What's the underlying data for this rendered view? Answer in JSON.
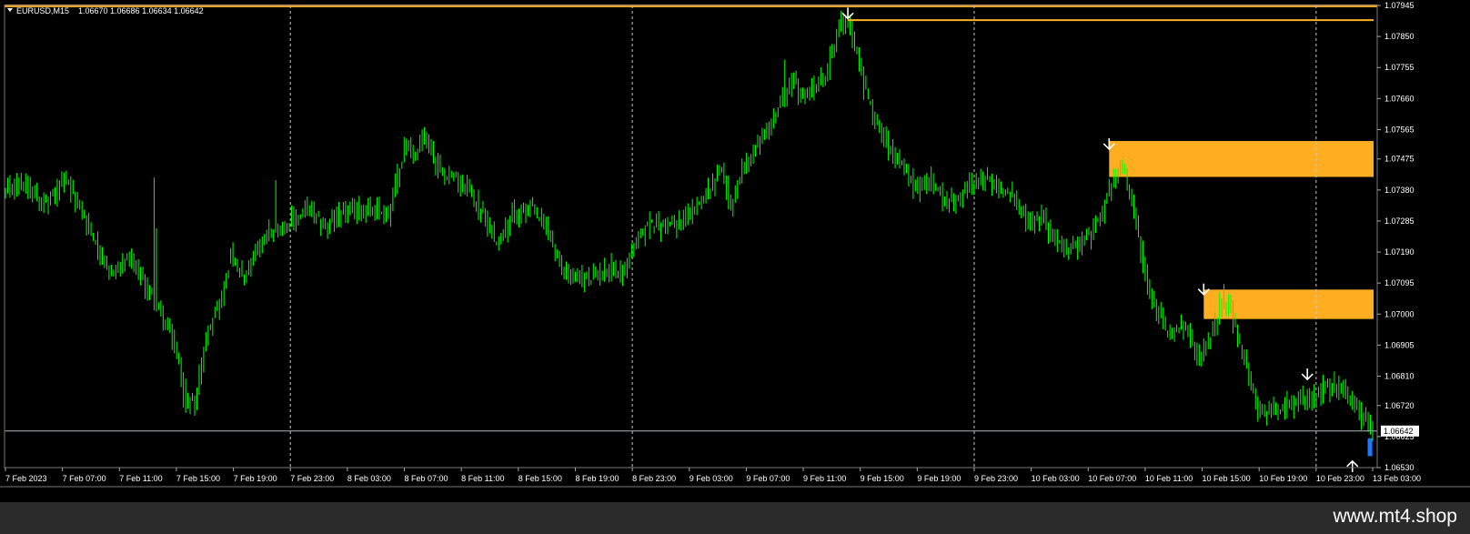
{
  "header": {
    "symbol": "EURUSD,M15",
    "quote": "1.06670 1.06686 1.06634 1.06642"
  },
  "footer": {
    "brand": "www.mt4.shop"
  },
  "colors": {
    "background": "#000000",
    "candle": "#00ff00",
    "zone": "#ffae22",
    "current_price_line": "#aab4c0",
    "grid": "#c8c8c8",
    "arrow": "#ffffff",
    "current_bar": "#1e78ff"
  },
  "chart_data": {
    "type": "candlestick",
    "symbol": "EURUSD",
    "timeframe": "M15",
    "ylim": [
      1.0653,
      1.07945
    ],
    "y_ticks": [
      "1.07945",
      "1.07850",
      "1.07755",
      "1.07660",
      "1.07565",
      "1.07475",
      "1.07380",
      "1.07285",
      "1.07190",
      "1.07095",
      "1.07000",
      "1.06905",
      "1.06810",
      "1.06720",
      "1.06625",
      "1.06530"
    ],
    "x_ticks": [
      "7 Feb 2023",
      "7 Feb 07:00",
      "7 Feb 11:00",
      "7 Feb 15:00",
      "7 Feb 19:00",
      "7 Feb 23:00",
      "8 Feb 03:00",
      "8 Feb 07:00",
      "8 Feb 11:00",
      "8 Feb 15:00",
      "8 Feb 19:00",
      "8 Feb 23:00",
      "9 Feb 03:00",
      "9 Feb 07:00",
      "9 Feb 11:00",
      "9 Feb 15:00",
      "9 Feb 19:00",
      "9 Feb 23:00",
      "10 Feb 03:00",
      "10 Feb 07:00",
      "10 Feb 11:00",
      "10 Feb 15:00",
      "10 Feb 19:00",
      "10 Feb 23:00",
      "13 Feb 03:00"
    ],
    "grid": "vertical dashed at 7 Feb 23:00, 8 Feb 23:00, 9 Feb 23:00, 10 Feb 23:00",
    "current_price": "1.06642",
    "close_path": [
      {
        "i": 0,
        "p": 1.0737
      },
      {
        "i": 6,
        "p": 1.0741
      },
      {
        "i": 12,
        "p": 1.0738
      },
      {
        "i": 18,
        "p": 1.0733
      },
      {
        "i": 26,
        "p": 1.0741
      },
      {
        "i": 32,
        "p": 1.0734
      },
      {
        "i": 40,
        "p": 1.0722
      },
      {
        "i": 46,
        "p": 1.0712
      },
      {
        "i": 54,
        "p": 1.0717
      },
      {
        "i": 60,
        "p": 1.0711
      },
      {
        "i": 68,
        "p": 1.0702
      },
      {
        "i": 76,
        "p": 1.0688
      },
      {
        "i": 80,
        "p": 1.0672
      },
      {
        "i": 84,
        "p": 1.0674
      },
      {
        "i": 90,
        "p": 1.0696
      },
      {
        "i": 96,
        "p": 1.0705
      },
      {
        "i": 100,
        "p": 1.0718
      },
      {
        "i": 106,
        "p": 1.071
      },
      {
        "i": 112,
        "p": 1.0721
      },
      {
        "i": 118,
        "p": 1.0726
      },
      {
        "i": 126,
        "p": 1.0728
      },
      {
        "i": 134,
        "p": 1.0732
      },
      {
        "i": 142,
        "p": 1.0727
      },
      {
        "i": 150,
        "p": 1.0731
      },
      {
        "i": 156,
        "p": 1.0732
      },
      {
        "i": 164,
        "p": 1.0732
      },
      {
        "i": 170,
        "p": 1.0731
      },
      {
        "i": 174,
        "p": 1.0742
      },
      {
        "i": 178,
        "p": 1.0753
      },
      {
        "i": 182,
        "p": 1.0748
      },
      {
        "i": 186,
        "p": 1.0755
      },
      {
        "i": 192,
        "p": 1.0745
      },
      {
        "i": 198,
        "p": 1.0742
      },
      {
        "i": 206,
        "p": 1.0738
      },
      {
        "i": 212,
        "p": 1.073
      },
      {
        "i": 218,
        "p": 1.0722
      },
      {
        "i": 226,
        "p": 1.0731
      },
      {
        "i": 234,
        "p": 1.0732
      },
      {
        "i": 240,
        "p": 1.0727
      },
      {
        "i": 246,
        "p": 1.0715
      },
      {
        "i": 252,
        "p": 1.0711
      },
      {
        "i": 260,
        "p": 1.0711
      },
      {
        "i": 268,
        "p": 1.0714
      },
      {
        "i": 274,
        "p": 1.0713
      },
      {
        "i": 280,
        "p": 1.0722
      },
      {
        "i": 286,
        "p": 1.0728
      },
      {
        "i": 292,
        "p": 1.0727
      },
      {
        "i": 298,
        "p": 1.0728
      },
      {
        "i": 306,
        "p": 1.0732
      },
      {
        "i": 312,
        "p": 1.0738
      },
      {
        "i": 318,
        "p": 1.0745
      },
      {
        "i": 322,
        "p": 1.0731
      },
      {
        "i": 326,
        "p": 1.0742
      },
      {
        "i": 332,
        "p": 1.075
      },
      {
        "i": 338,
        "p": 1.0757
      },
      {
        "i": 344,
        "p": 1.0765
      },
      {
        "i": 350,
        "p": 1.0772
      },
      {
        "i": 354,
        "p": 1.0765
      },
      {
        "i": 358,
        "p": 1.077
      },
      {
        "i": 364,
        "p": 1.0772
      },
      {
        "i": 370,
        "p": 1.0789
      },
      {
        "i": 374,
        "p": 1.079
      },
      {
        "i": 378,
        "p": 1.0779
      },
      {
        "i": 382,
        "p": 1.0768
      },
      {
        "i": 386,
        "p": 1.076
      },
      {
        "i": 392,
        "p": 1.0752
      },
      {
        "i": 398,
        "p": 1.0745
      },
      {
        "i": 404,
        "p": 1.0738
      },
      {
        "i": 410,
        "p": 1.0742
      },
      {
        "i": 416,
        "p": 1.0735
      },
      {
        "i": 422,
        "p": 1.0734
      },
      {
        "i": 428,
        "p": 1.074
      },
      {
        "i": 436,
        "p": 1.0741
      },
      {
        "i": 442,
        "p": 1.0738
      },
      {
        "i": 448,
        "p": 1.0735
      },
      {
        "i": 454,
        "p": 1.0728
      },
      {
        "i": 460,
        "p": 1.073
      },
      {
        "i": 466,
        "p": 1.0722
      },
      {
        "i": 472,
        "p": 1.072
      },
      {
        "i": 480,
        "p": 1.0723
      },
      {
        "i": 486,
        "p": 1.0729
      },
      {
        "i": 492,
        "p": 1.0741
      },
      {
        "i": 496,
        "p": 1.0745
      },
      {
        "i": 500,
        "p": 1.0735
      },
      {
        "i": 504,
        "p": 1.072
      },
      {
        "i": 508,
        "p": 1.0706
      },
      {
        "i": 512,
        "p": 1.07
      },
      {
        "i": 516,
        "p": 1.0693
      },
      {
        "i": 522,
        "p": 1.0696
      },
      {
        "i": 526,
        "p": 1.0692
      },
      {
        "i": 530,
        "p": 1.0686
      },
      {
        "i": 536,
        "p": 1.0695
      },
      {
        "i": 540,
        "p": 1.0705
      },
      {
        "i": 544,
        "p": 1.0701
      },
      {
        "i": 548,
        "p": 1.069
      },
      {
        "i": 552,
        "p": 1.068
      },
      {
        "i": 556,
        "p": 1.067
      },
      {
        "i": 562,
        "p": 1.0671
      },
      {
        "i": 570,
        "p": 1.0672
      },
      {
        "i": 578,
        "p": 1.0674
      },
      {
        "i": 584,
        "p": 1.0677
      },
      {
        "i": 590,
        "p": 1.0678
      },
      {
        "i": 596,
        "p": 1.0675
      },
      {
        "i": 600,
        "p": 1.0671
      },
      {
        "i": 604,
        "p": 1.0667
      },
      {
        "i": 607,
        "p": 1.0664
      }
    ],
    "bar_count": 608,
    "resistance_line": {
      "price": 1.079,
      "from_bar": 374
    },
    "supply_zones": [
      {
        "top": 1.0753,
        "bottom": 1.0742,
        "from_bar": 490
      },
      {
        "top": 1.07075,
        "bottom": 1.06985,
        "from_bar": 532
      }
    ],
    "top_band": {
      "price": 1.07955
    },
    "sell_arrows": [
      {
        "bar": 374,
        "price": 1.07905
      },
      {
        "bar": 490,
        "price": 1.07505
      },
      {
        "bar": 532,
        "price": 1.0706
      },
      {
        "bar": 578,
        "price": 1.068
      }
    ],
    "buy_arrows": [
      {
        "bar": 598,
        "price": 1.0655
      }
    ]
  }
}
